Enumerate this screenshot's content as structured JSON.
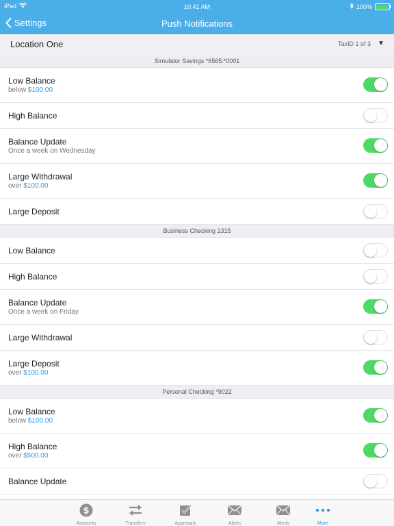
{
  "status_bar": {
    "device": "iPad",
    "time": "10:41 AM",
    "battery": "100%",
    "battery_level": 1.0
  },
  "nav": {
    "back_label": "Settings",
    "title": "Push Notifications"
  },
  "location": {
    "name": "Location One",
    "tax_id": "TaxID 1 of 3"
  },
  "sections": [
    {
      "header": "Simulator Savings *6565:*0001",
      "rows": [
        {
          "label": "Low Balance",
          "prefix": "below ",
          "amount": "$100.00",
          "detail": "",
          "on": true
        },
        {
          "label": "High Balance",
          "prefix": "",
          "amount": "",
          "detail": "",
          "on": false
        },
        {
          "label": "Balance Update",
          "prefix": "",
          "amount": "",
          "detail": "Once a week on Wednesday",
          "on": true
        },
        {
          "label": "Large Withdrawal",
          "prefix": "over ",
          "amount": "$100.00",
          "detail": "",
          "on": true
        },
        {
          "label": "Large Deposit",
          "prefix": "",
          "amount": "",
          "detail": "",
          "on": false
        }
      ]
    },
    {
      "header": "Business Checking 1315",
      "rows": [
        {
          "label": "Low Balance",
          "prefix": "",
          "amount": "",
          "detail": "",
          "on": false
        },
        {
          "label": "High Balance",
          "prefix": "",
          "amount": "",
          "detail": "",
          "on": false
        },
        {
          "label": "Balance Update",
          "prefix": "",
          "amount": "",
          "detail": "Once a week on Friday",
          "on": true
        },
        {
          "label": "Large Withdrawal",
          "prefix": "",
          "amount": "",
          "detail": "",
          "on": false
        },
        {
          "label": "Large Deposit",
          "prefix": "over ",
          "amount": "$100.00",
          "detail": "",
          "on": true
        }
      ]
    },
    {
      "header": "Personal Checking *9022",
      "rows": [
        {
          "label": "Low Balance",
          "prefix": "below ",
          "amount": "$100.00",
          "detail": "",
          "on": true
        },
        {
          "label": "High Balance",
          "prefix": "over ",
          "amount": "$500.00",
          "detail": "",
          "on": true
        },
        {
          "label": "Balance Update",
          "prefix": "",
          "amount": "",
          "detail": "",
          "on": false
        }
      ]
    }
  ],
  "tabs": [
    {
      "label": "Accounts",
      "icon": "dollar-icon",
      "active": false
    },
    {
      "label": "Transfers",
      "icon": "transfer-arrows-icon",
      "active": false
    },
    {
      "label": "Approvals",
      "icon": "checkbox-icon",
      "active": false
    },
    {
      "label": "Alerts",
      "icon": "envelope-icon",
      "active": false
    },
    {
      "label": "Alerts",
      "icon": "envelope-icon",
      "active": false
    },
    {
      "label": "More",
      "icon": "more-dots-icon",
      "active": true
    }
  ],
  "colors": {
    "nav_blue": "#4aaee8",
    "toggle_green": "#4cd964",
    "link_blue": "#2d9be0",
    "battery_green": "#4cd964"
  }
}
